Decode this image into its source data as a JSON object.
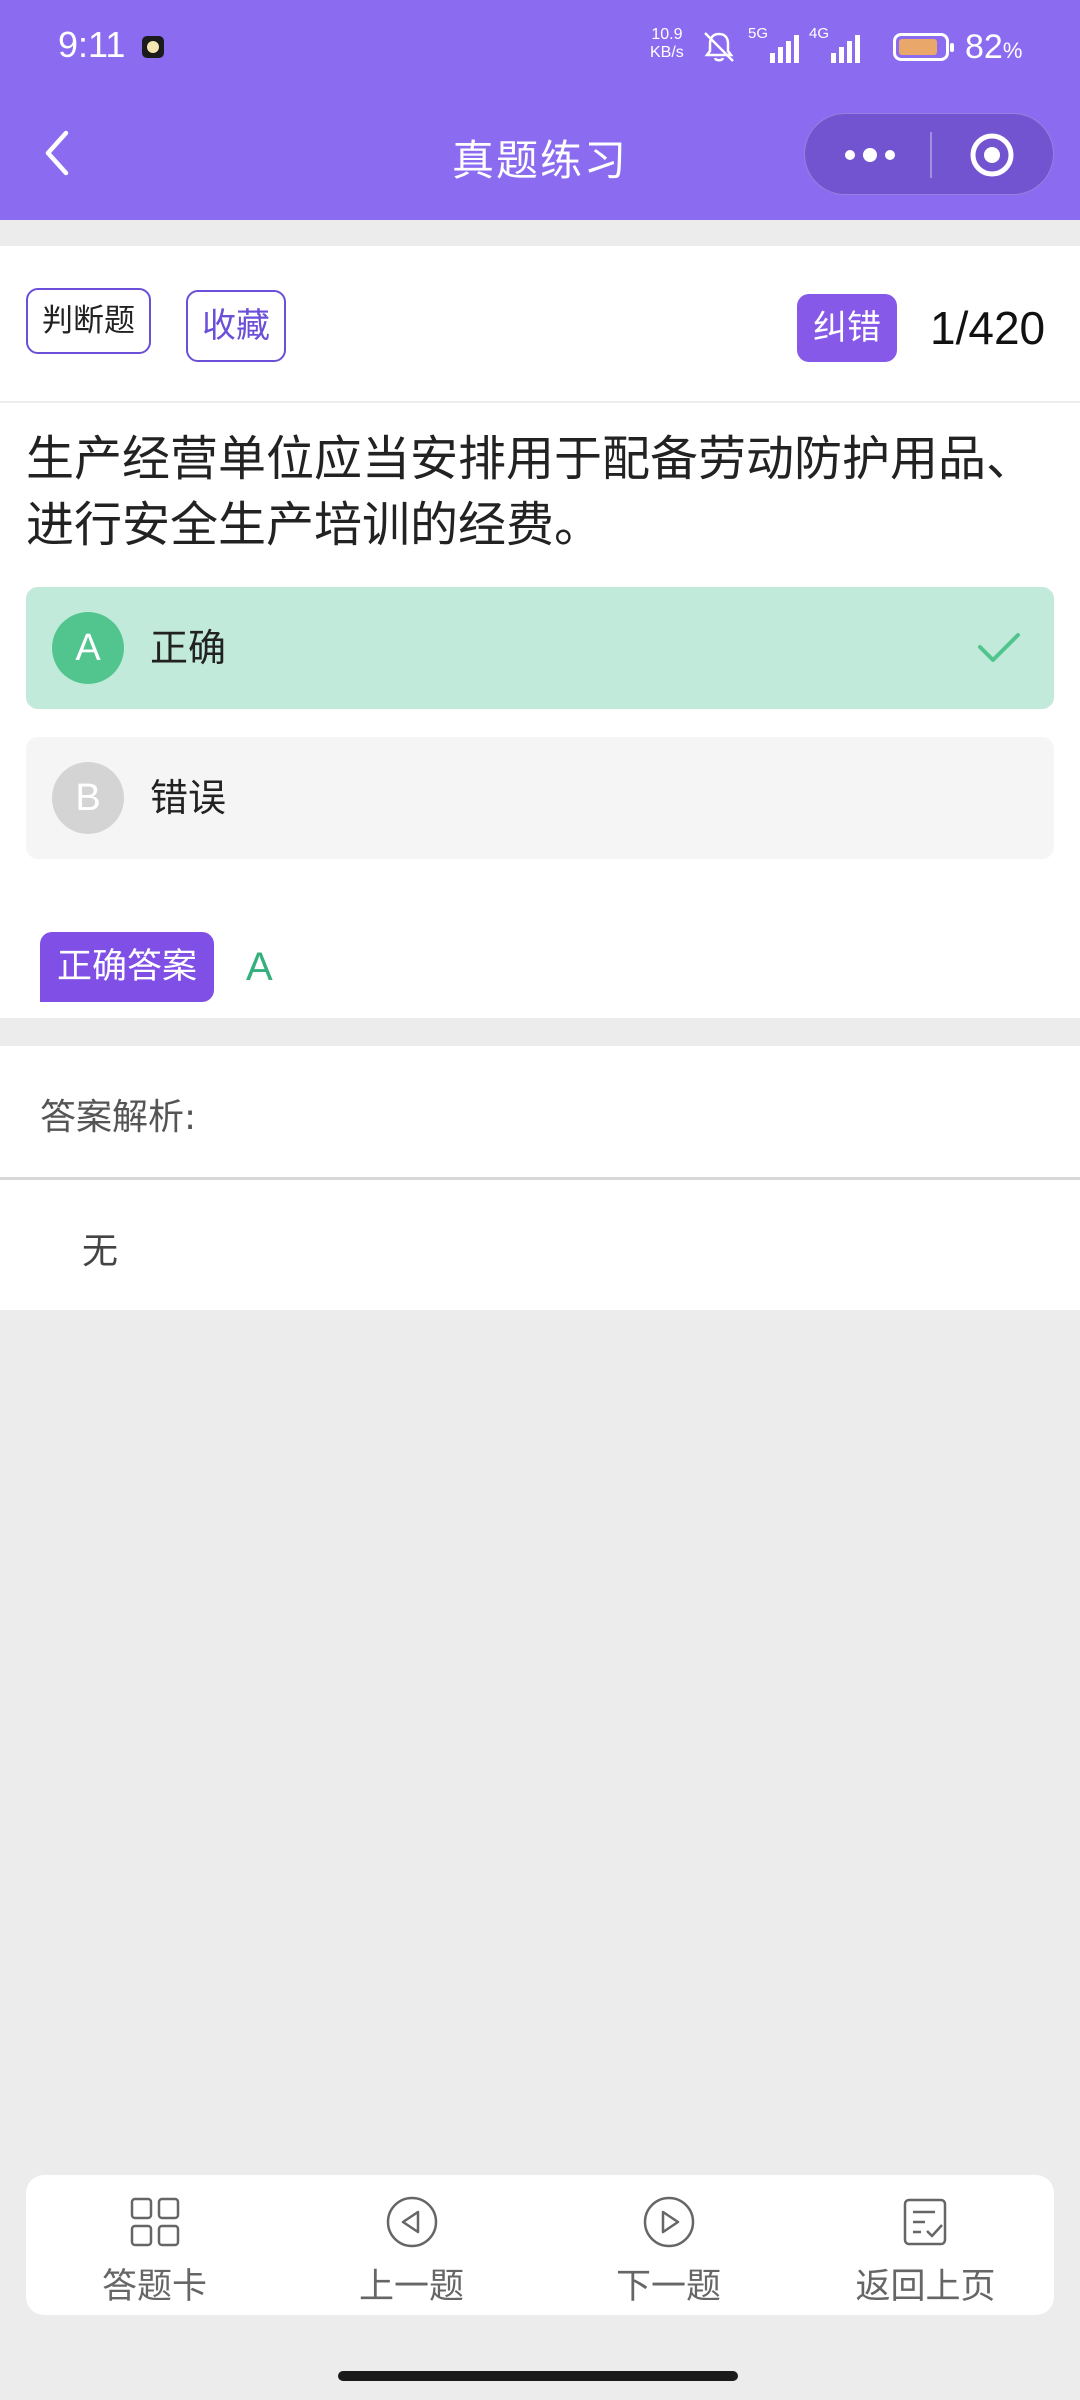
{
  "status_bar": {
    "time": "9:11",
    "net_speed_value": "10.9",
    "net_speed_unit": "KB/s",
    "signal_1_label": "5G",
    "signal_2_label": "4G",
    "battery_percent": "82",
    "battery_suffix": "%"
  },
  "nav": {
    "title": "真题练习"
  },
  "question": {
    "type_tag": "判断题",
    "favorite_label": "收藏",
    "report_error_label": "纠错",
    "progress": "1/420",
    "text": "生产经营单位应当安排用于配备劳动防护用品、进行安全生产培训的经费。",
    "options": [
      {
        "letter": "A",
        "text": "正确",
        "state": "correct-selected"
      },
      {
        "letter": "B",
        "text": "错误",
        "state": "unselected"
      }
    ],
    "answer_label": "正确答案",
    "answer_value": "A"
  },
  "analysis": {
    "label": "答案解析:",
    "text": "无"
  },
  "bottom_bar": {
    "items": [
      {
        "label": "答题卡",
        "icon": "grid-icon"
      },
      {
        "label": "上一题",
        "icon": "play-left-icon"
      },
      {
        "label": "下一题",
        "icon": "play-right-icon"
      },
      {
        "label": "返回上页",
        "icon": "checklist-icon"
      }
    ]
  },
  "colors": {
    "brand": "#8b6cf1",
    "correct_green": "#52c58f",
    "correct_bg": "#c1eadb",
    "page_bg": "#ececec"
  }
}
